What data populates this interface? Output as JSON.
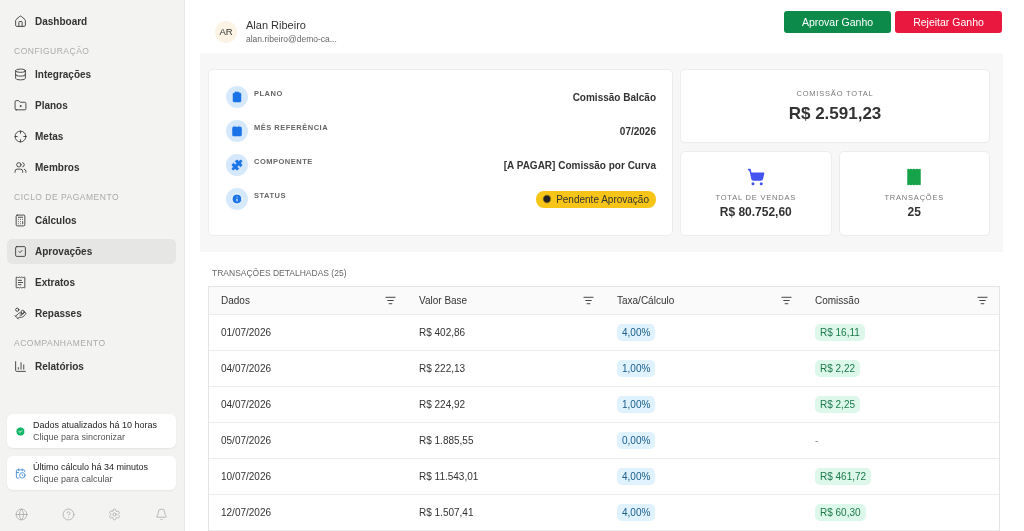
{
  "sidebar": {
    "sections": [
      {
        "items": [
          {
            "label": "Dashboard",
            "selected": false
          }
        ]
      },
      {
        "title": "CONFIGURAÇÃO",
        "items": [
          {
            "label": "Integrações",
            "selected": false
          },
          {
            "label": "Planos",
            "selected": false
          },
          {
            "label": "Metas",
            "selected": false
          },
          {
            "label": "Membros",
            "selected": false
          }
        ]
      },
      {
        "title": "CICLO DE PAGAMENTO",
        "items": [
          {
            "label": "Cálculos",
            "selected": false
          },
          {
            "label": "Aprovações",
            "selected": true
          },
          {
            "label": "Extratos",
            "selected": false
          },
          {
            "label": "Repasses",
            "selected": false
          }
        ]
      },
      {
        "title": "ACOMPANHAMENTO",
        "items": [
          {
            "label": "Relatórios",
            "selected": false
          }
        ]
      }
    ],
    "status_cards": [
      {
        "kind": "sync",
        "title": "Dados atualizados há 10 horas",
        "subtitle": "Clique para sincronizar"
      },
      {
        "kind": "calc",
        "title": "Último cálculo há 34 minutos",
        "subtitle": "Clique para calcular"
      }
    ]
  },
  "header": {
    "initials": "AR",
    "name": "Alan Ribeiro",
    "email": "alan.ribeiro@demo-ca...",
    "buttons": [
      {
        "kind": "approve",
        "label": "Aprovar Ganho"
      },
      {
        "kind": "reject",
        "label": "Rejeitar Ganho"
      }
    ]
  },
  "details": [
    {
      "kind": "text",
      "label": "PLANO",
      "value": "Comissão Balcão"
    },
    {
      "kind": "text",
      "label": "MÊS REFERÊNCIA",
      "value": "07/2026"
    },
    {
      "kind": "text",
      "label": "COMPONENTE",
      "value": "[A PAGAR] Comissão por Curva"
    },
    {
      "kind": "badge",
      "label": "STATUS",
      "value": "Pendente Aprovação"
    }
  ],
  "total": {
    "label": "COMISSÃO TOTAL",
    "value": "R$ 2.591,23"
  },
  "stats": [
    {
      "kind": "sales",
      "label": "TOTAL DE VENDAS",
      "value": "R$ 80.752,60"
    },
    {
      "kind": "transactions",
      "label": "TRANSAÇÕES",
      "value": "25"
    }
  ],
  "table": {
    "title": "TRANSAÇÕES DETALHADAS (25)",
    "columns": [
      "Dados",
      "Valor Base",
      "Taxa/Cálculo",
      "Comissão"
    ],
    "rows": [
      {
        "date": "01/07/2026",
        "base": "R$ 402,86",
        "rate": "4,00%",
        "commission": {
          "kind": "badge",
          "text": "R$ 16,11"
        }
      },
      {
        "date": "04/07/2026",
        "base": "R$ 222,13",
        "rate": "1,00%",
        "commission": {
          "kind": "badge",
          "text": "R$ 2,22"
        }
      },
      {
        "date": "04/07/2026",
        "base": "R$ 224,92",
        "rate": "1,00%",
        "commission": {
          "kind": "badge",
          "text": "R$ 2,25"
        }
      },
      {
        "date": "05/07/2026",
        "base": "R$ 1.885,55",
        "rate": "0,00%",
        "commission": {
          "kind": "text",
          "text": "-"
        }
      },
      {
        "date": "10/07/2026",
        "base": "R$ 11.543,01",
        "rate": "4,00%",
        "commission": {
          "kind": "badge",
          "text": "R$ 461,72"
        }
      },
      {
        "date": "12/07/2026",
        "base": "R$ 1.507,41",
        "rate": "4,00%",
        "commission": {
          "kind": "badge",
          "text": "R$ 60,30"
        }
      }
    ]
  }
}
